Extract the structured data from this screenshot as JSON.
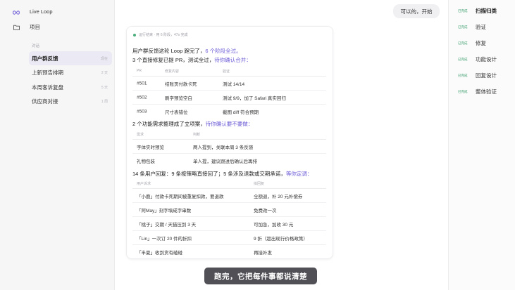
{
  "sidebar": {
    "top_items": [
      {
        "label": "Live Loop",
        "icon": "infinity-icon"
      },
      {
        "label": "项目",
        "icon": "folder-icon"
      }
    ],
    "section_label": "对话",
    "items": [
      {
        "label": "用户群反馈",
        "meta": "现在",
        "active": true
      },
      {
        "label": "上新预告排期",
        "meta": "2 天",
        "active": false
      },
      {
        "label": "本周客诉复盘",
        "meta": "5 天",
        "active": false
      },
      {
        "label": "供应商对接",
        "meta": "1 周",
        "active": false
      }
    ]
  },
  "chat": {
    "user_message": "可以的，开始"
  },
  "card": {
    "status": "运行结束 · 用 6 阶段，47s 完成",
    "summary_prefix": "用户群反馈这轮 Loop 跑完了，",
    "summary_highlight": "6 个阶段全过。",
    "pr_intro_prefix": "3 个直接修复已提 PR，测试全过，",
    "pr_intro_highlight": "待你确认合并：",
    "pr_table": {
      "headers": [
        "PR",
        "修复内容",
        "验证"
      ],
      "rows": [
        [
          "#501",
          "结账页付款卡死",
          "测试 14/14"
        ],
        [
          "#502",
          "刷字预览空白",
          "测试 9/9，加了 Safari 真实回归"
        ],
        [
          "#503",
          "尺寸表错位",
          "截图 diff 符合预期"
        ]
      ]
    },
    "feature_intro_prefix": "2 个功能需求整理成了立项案，",
    "feature_intro_highlight": "待你确认要不要做：",
    "feature_table": {
      "headers": [
        "需求",
        "判断"
      ],
      "rows": [
        [
          "字体实时预览",
          "两人提到，关联本周 3 条反馈"
        ],
        [
          "礼物包装",
          "单人提，建议跟进后确认后再排"
        ]
      ]
    },
    "reply_intro_prefix": "14 条用户回复：9 条按策略直接回了；5 条涉及退款或交期承诺，",
    "reply_intro_highlight": "等你定调：",
    "reply_table": {
      "headers": [
        "用户诉求",
        "拟回复"
      ],
      "rows": [
        [
          "「小鹿」付款卡死期间被重复扣款，要退款",
          "全额退，补 20 元补偿券"
        ],
        [
          "「阿May」刻字填成字串数",
          "免费改一次"
        ],
        [
          "「桃子」交期 / 天猫压到 3 天",
          "可加急，加收 30 元"
        ],
        [
          "「Lin」一次订 20 件的折扣",
          "9 折（超出现行价格政策）"
        ],
        [
          "「半夏」收到货有磕碰",
          "再接补发"
        ]
      ]
    }
  },
  "caption": "跑完，它把每件事都说清楚",
  "right_panel": {
    "items": [
      {
        "status": "已完成",
        "label": "扫描归类"
      },
      {
        "status": "已完成",
        "label": "验证"
      },
      {
        "status": "已完成",
        "label": "修复"
      },
      {
        "status": "已完成",
        "label": "功能设计"
      },
      {
        "status": "已完成",
        "label": "回复设计"
      },
      {
        "status": "已完成",
        "label": "整体验证"
      }
    ]
  }
}
